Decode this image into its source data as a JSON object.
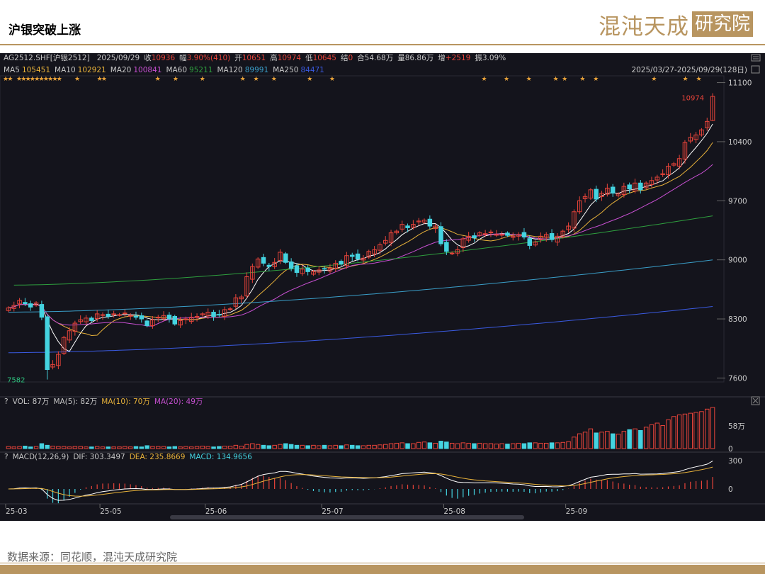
{
  "header": {
    "title": "沪银突破上涨",
    "logo_text": "混沌天成",
    "logo_box_text": "研究院"
  },
  "footer": {
    "source": "数据来源：同花顺，混沌天成研究院"
  },
  "colors": {
    "bg": "#14141c",
    "up": "#e8443a",
    "down": "#44d3e0",
    "gold": "#b89560",
    "ma5": "#ffffff",
    "ma10": "#e8b23a",
    "ma20": "#c64fd0",
    "ma60": "#2e9e3e",
    "ma120": "#3a9ec8",
    "ma250": "#3a5ae0"
  },
  "chart_data": {
    "type": "candlestick",
    "quote_bar": {
      "symbol": "AG2512.SHF[沪银2512]",
      "date": "2025/09/29",
      "close_label": "收",
      "close": "10936",
      "chg_label": "幅",
      "chg": "3.90%(410)",
      "open_label": "开",
      "open": "10651",
      "high_label": "高",
      "high": "10974",
      "low_label": "低",
      "low": "10645",
      "settle_label": "结",
      "settle": "0",
      "oi_label": "合",
      "oi": "54.68万",
      "vol_label": "量",
      "vol": "86.86万",
      "inc_label": "增",
      "inc": "+2519",
      "amp_label": "振",
      "amp": "3.09%"
    },
    "ma_bar": [
      {
        "name": "MA5",
        "value": "105451"
      },
      {
        "name": "MA10",
        "value": "102921"
      },
      {
        "name": "MA20",
        "value": "100841"
      },
      {
        "name": "MA60",
        "value": "95211"
      },
      {
        "name": "MA120",
        "value": "89991"
      },
      {
        "name": "MA250",
        "value": "84471"
      }
    ],
    "date_range": "2025/03/27-2025/09/29(128日)",
    "y_ticks": [
      11100,
      10400,
      9700,
      9000,
      8300,
      7600
    ],
    "ylim": [
      7570,
      11130
    ],
    "max_label": "10974",
    "min_label": "7582",
    "x_ticks": [
      {
        "label": "25-03",
        "i": 0
      },
      {
        "label": "25-05",
        "i": 17
      },
      {
        "label": "25-06",
        "i": 36
      },
      {
        "label": "25-07",
        "i": 57
      },
      {
        "label": "25-08",
        "i": 79
      },
      {
        "label": "25-09",
        "i": 101
      }
    ],
    "n": 128,
    "closes": [
      8430,
      8460,
      8520,
      8480,
      8440,
      8490,
      8320,
      7700,
      7760,
      7880,
      8080,
      8160,
      8250,
      8290,
      8310,
      8280,
      8360,
      8350,
      8330,
      8360,
      8350,
      8370,
      8340,
      8320,
      8300,
      8220,
      8290,
      8320,
      8340,
      8300,
      8240,
      8280,
      8300,
      8320,
      8330,
      8360,
      8380,
      8330,
      8350,
      8410,
      8420,
      8550,
      8560,
      8800,
      8920,
      9010,
      8960,
      8920,
      8970,
      9090,
      8970,
      8900,
      8850,
      8890,
      8860,
      8860,
      8880,
      8890,
      8900,
      8960,
      8950,
      9050,
      9040,
      9010,
      9020,
      9100,
      9120,
      9180,
      9230,
      9320,
      9340,
      9420,
      9380,
      9420,
      9460,
      9470,
      9400,
      9400,
      9190,
      9100,
      9080,
      9120,
      9250,
      9280,
      9260,
      9320,
      9310,
      9330,
      9300,
      9300,
      9290,
      9280,
      9300,
      9270,
      9170,
      9210,
      9280,
      9300,
      9240,
      9280,
      9340,
      9400,
      9570,
      9700,
      9750,
      9830,
      9720,
      9790,
      9850,
      9790,
      9780,
      9870,
      9840,
      9910,
      9830,
      9910,
      9940,
      9980,
      10020,
      10110,
      10140,
      10200,
      10390,
      10450,
      10480,
      10540,
      10640,
      10936
    ],
    "vol_rel": [
      0.05,
      0.04,
      0.05,
      0.06,
      0.04,
      0.05,
      0.12,
      0.08,
      0.06,
      0.05,
      0.05,
      0.04,
      0.05,
      0.05,
      0.04,
      0.04,
      0.05,
      0.04,
      0.04,
      0.04,
      0.04,
      0.05,
      0.04,
      0.05,
      0.04,
      0.07,
      0.05,
      0.05,
      0.05,
      0.04,
      0.05,
      0.04,
      0.05,
      0.04,
      0.05,
      0.06,
      0.05,
      0.04,
      0.05,
      0.06,
      0.06,
      0.08,
      0.06,
      0.1,
      0.12,
      0.1,
      0.08,
      0.07,
      0.08,
      0.1,
      0.12,
      0.1,
      0.08,
      0.08,
      0.07,
      0.08,
      0.07,
      0.08,
      0.07,
      0.08,
      0.07,
      0.09,
      0.08,
      0.07,
      0.07,
      0.08,
      0.08,
      0.09,
      0.1,
      0.12,
      0.13,
      0.14,
      0.12,
      0.12,
      0.15,
      0.16,
      0.14,
      0.13,
      0.18,
      0.16,
      0.13,
      0.12,
      0.14,
      0.13,
      0.12,
      0.13,
      0.12,
      0.12,
      0.11,
      0.12,
      0.11,
      0.12,
      0.13,
      0.12,
      0.14,
      0.14,
      0.13,
      0.13,
      0.14,
      0.14,
      0.15,
      0.17,
      0.28,
      0.36,
      0.4,
      0.48,
      0.38,
      0.4,
      0.42,
      0.36,
      0.35,
      0.42,
      0.46,
      0.48,
      0.44,
      0.52,
      0.58,
      0.62,
      0.56,
      0.7,
      0.78,
      0.82,
      0.84,
      0.86,
      0.88,
      0.9,
      0.96,
      1.0
    ],
    "vol_label": "VOL: 87万",
    "vol_ma5": "MA(5): 82万",
    "vol_ma10": "MA(10): 70万",
    "vol_ma20": "MA(20): 49万",
    "vol_ticks": [
      {
        "label": "58万",
        "rel": 0.55
      },
      {
        "label": "0",
        "rel": 0
      }
    ],
    "macd_label": "MACD(12,26,9)",
    "dif": "DIF: 303.3497",
    "dea": "DEA: 235.8669",
    "macd": "MACD: 134.9656",
    "macd_ticks": [
      {
        "label": "300",
        "v": 300
      },
      {
        "label": "0",
        "v": 0
      }
    ],
    "stars": [
      0,
      1,
      3,
      4,
      5,
      6,
      7,
      8,
      9,
      10,
      11,
      12,
      16,
      21,
      22,
      34,
      38,
      44,
      53,
      56,
      60,
      68,
      73,
      107,
      112,
      117,
      123,
      125,
      129,
      132,
      145,
      152,
      155
    ]
  }
}
